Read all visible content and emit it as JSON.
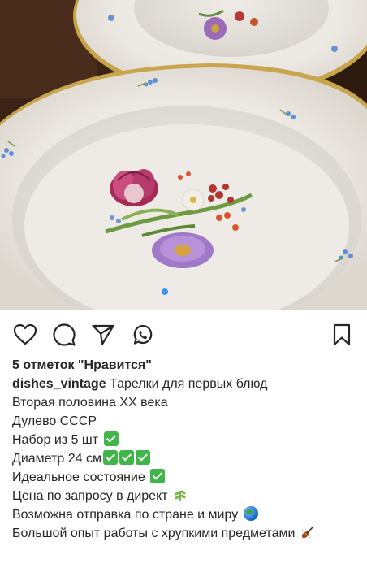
{
  "post": {
    "likes_text": "5 отметок \"Нравится\"",
    "username": "dishes_vintage",
    "caption_first": "Тарелки для первых блюд",
    "caption_lines": [
      "Вторая половина XX века",
      "Дулево СССР",
      "Набор из 5 шт",
      "Диаметр 24 см",
      "Идеальное состояние",
      "Цена по запросу в директ",
      "Возможна отправка по стране и миру",
      "Большой опыт работы с хрупкими предметами"
    ]
  },
  "icons": {
    "like": "heart-icon",
    "comment": "comment-icon",
    "share": "paper-plane-icon",
    "whatsapp": "whatsapp-icon",
    "save": "bookmark-icon"
  },
  "colors": {
    "carousel_active": "#3897f0",
    "checkmark": "#3fb54a"
  }
}
